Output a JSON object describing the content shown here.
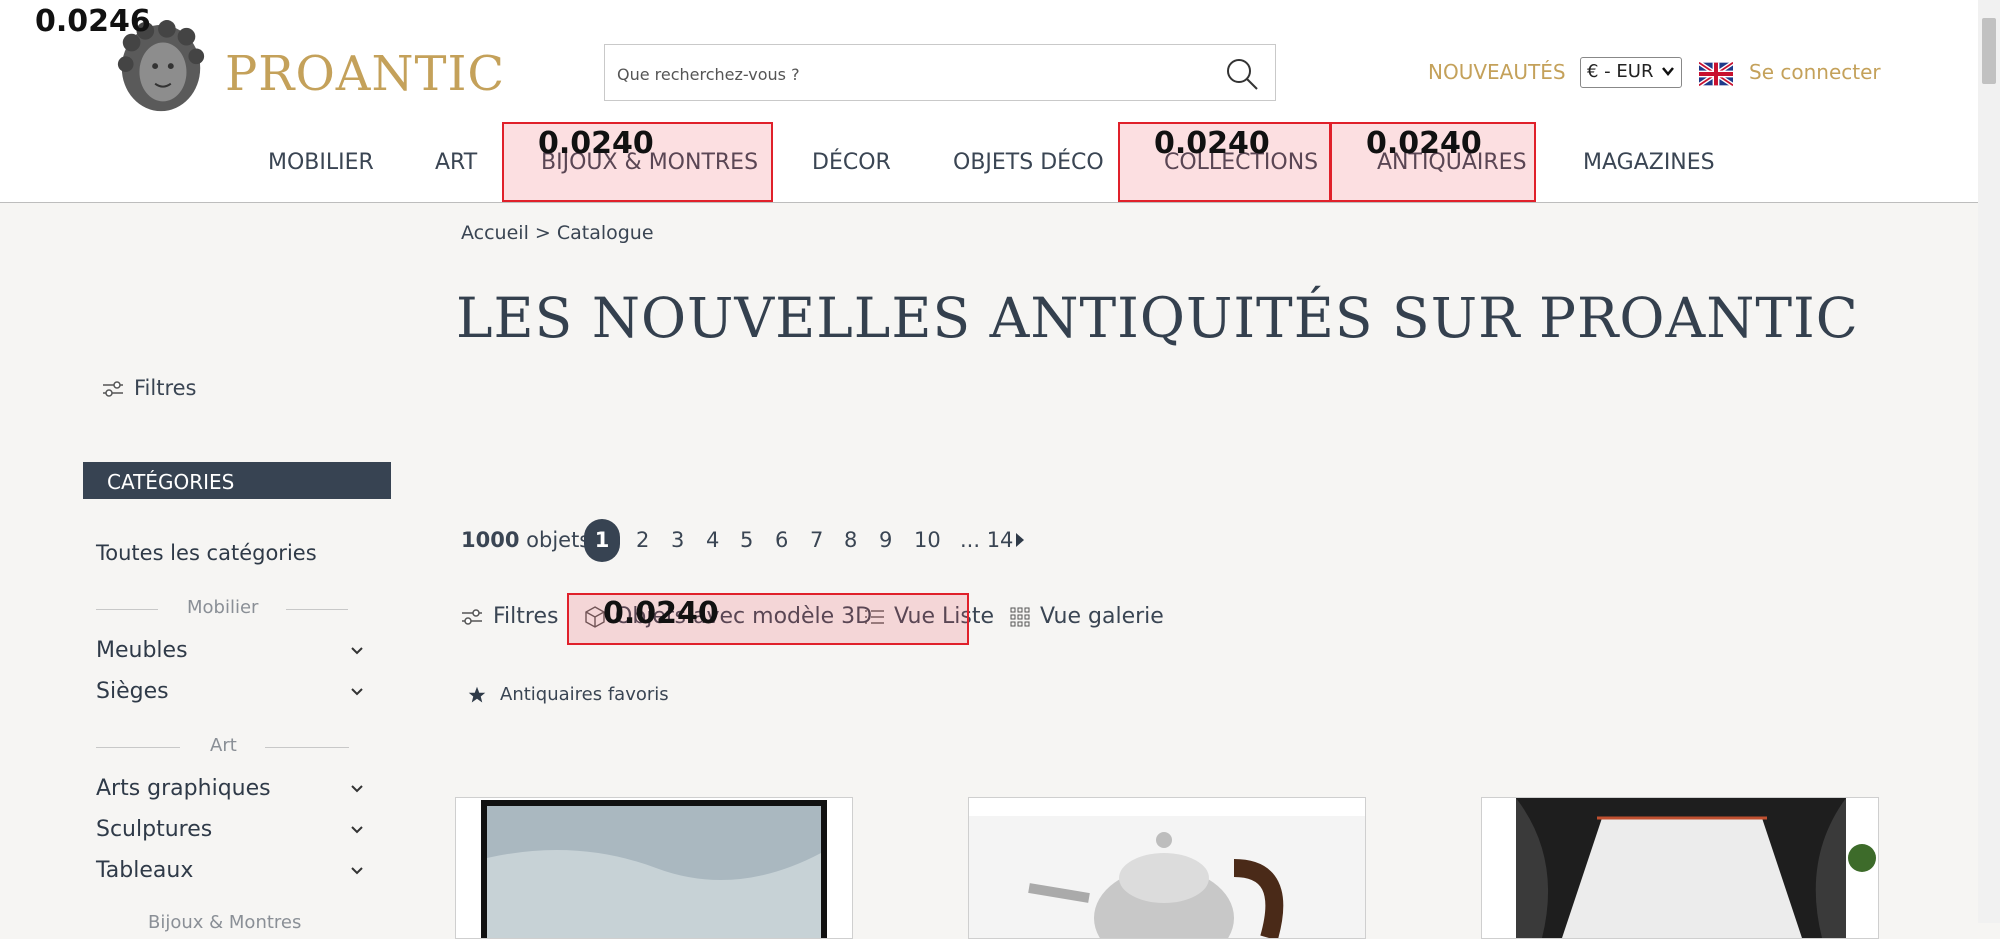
{
  "header": {
    "logo_text": "PROANTIC",
    "search_placeholder": "Que recherchez-vous ?",
    "nouveautes": "NOUVEAUTÉS",
    "currency": "€ - EUR",
    "connect": "Se connecter"
  },
  "nav": {
    "items": [
      "MOBILIER",
      "ART",
      "BIJOUX & MONTRES",
      "DÉCOR",
      "OBJETS DÉCO",
      "COLLECTIONS",
      "ANTIQUAIRES",
      "MAGAZINES"
    ]
  },
  "overlay": {
    "scores": [
      "0.0246",
      "0.0240",
      "0.0240",
      "0.0240",
      "0.0240"
    ]
  },
  "breadcrumb": "Accueil > Catalogue",
  "page_title": "LES NOUVELLES ANTIQUITÉS SUR PROANTIC",
  "sidebar": {
    "filters_label": "Filtres",
    "categories_header": "CATÉGORIES",
    "all_categories": "Toutes les catégories",
    "groups": [
      {
        "label": "Mobilier",
        "items": [
          "Meubles",
          "Sièges"
        ]
      },
      {
        "label": "Art",
        "items": [
          "Arts graphiques",
          "Sculptures",
          "Tableaux"
        ]
      },
      {
        "label": "Bijoux & Montres",
        "items": []
      }
    ]
  },
  "results": {
    "count_number": "1000",
    "count_label": "objets",
    "pages": [
      "1",
      "2",
      "3",
      "4",
      "5",
      "6",
      "7",
      "8",
      "9",
      "10",
      "... 14"
    ],
    "current_page": "1"
  },
  "toolbar": {
    "filters": "Filtres",
    "model3d": "Objets avec modèle 3D",
    "list_view": "Vue Liste",
    "gallery_view": "Vue galerie",
    "favorites": "Antiquaires favoris"
  },
  "colors": {
    "gold": "#c4a15a",
    "navy": "#374352",
    "highlight_border": "#e0202a"
  },
  "icons": [
    "search-icon",
    "flag-uk-icon",
    "chevron-down-icon",
    "filter-icon",
    "cube-icon",
    "list-icon",
    "grid-icon",
    "star-icon",
    "arrow-right-icon"
  ]
}
